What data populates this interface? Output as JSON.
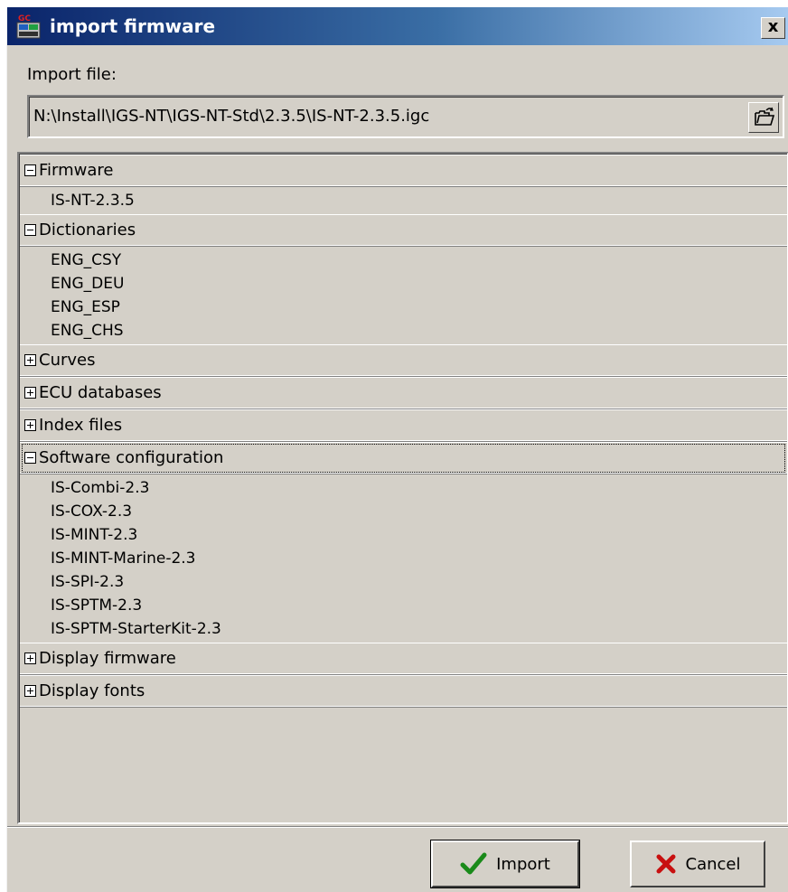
{
  "window": {
    "title": "import firmware",
    "close_label": "x"
  },
  "import_file": {
    "label": "Import file:",
    "path": "N:\\Install\\IGS-NT\\IGS-NT-Std\\2.3.5\\IS-NT-2.3.5.igc",
    "browse_icon": "open-folder-icon"
  },
  "tree": {
    "groups": [
      {
        "label": "Firmware",
        "expanded": true,
        "items": [
          "IS-NT-2.3.5"
        ]
      },
      {
        "label": "Dictionaries",
        "expanded": true,
        "items": [
          "ENG_CSY",
          "ENG_DEU",
          "ENG_ESP",
          "ENG_CHS"
        ]
      },
      {
        "label": "Curves",
        "expanded": false,
        "items": []
      },
      {
        "label": "ECU databases",
        "expanded": false,
        "items": []
      },
      {
        "label": "Index files",
        "expanded": false,
        "items": []
      },
      {
        "label": "Software configuration",
        "expanded": true,
        "focused": true,
        "items": [
          "IS-Combi-2.3",
          "IS-COX-2.3",
          "IS-MINT-2.3",
          "IS-MINT-Marine-2.3",
          "IS-SPI-2.3",
          "IS-SPTM-2.3",
          "IS-SPTM-StarterKit-2.3"
        ]
      },
      {
        "label": "Display firmware",
        "expanded": false,
        "items": []
      },
      {
        "label": "Display fonts",
        "expanded": false,
        "items": []
      }
    ]
  },
  "buttons": {
    "import_label": "Import",
    "cancel_label": "Cancel",
    "import_icon": "check-icon",
    "cancel_icon": "x-mark-icon",
    "check_color": "#1a8a1a",
    "cancel_color": "#c81010"
  }
}
